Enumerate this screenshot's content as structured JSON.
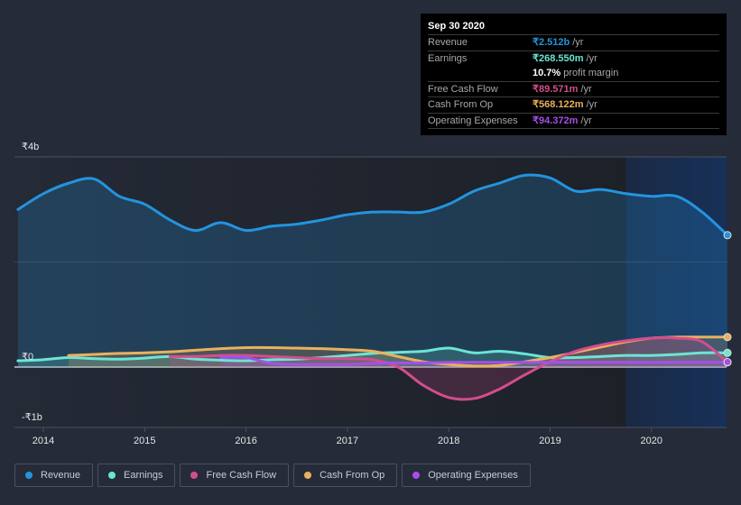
{
  "tooltip": {
    "date": "Sep 30 2020",
    "rows": [
      {
        "label": "Revenue",
        "value": "₹2.512b",
        "unit": "/yr",
        "color": "#2394df"
      },
      {
        "label": "Earnings",
        "value": "₹268.550m",
        "unit": "/yr",
        "color": "#6ce5d4"
      },
      {
        "label": "",
        "value": "10.7%",
        "unit": "profit margin",
        "color": "#ffffff"
      },
      {
        "label": "Free Cash Flow",
        "value": "₹89.571m",
        "unit": "/yr",
        "color": "#d34d8e"
      },
      {
        "label": "Cash From Op",
        "value": "₹568.122m",
        "unit": "/yr",
        "color": "#e9b15e"
      },
      {
        "label": "Operating Expenses",
        "value": "₹94.372m",
        "unit": "/yr",
        "color": "#a650e8"
      }
    ]
  },
  "legend": [
    {
      "label": "Revenue",
      "color": "#2394df"
    },
    {
      "label": "Earnings",
      "color": "#6ce5d4"
    },
    {
      "label": "Free Cash Flow",
      "color": "#d34d8e"
    },
    {
      "label": "Cash From Op",
      "color": "#e9b15e"
    },
    {
      "label": "Operating Expenses",
      "color": "#a650e8"
    }
  ],
  "chart_data": {
    "type": "area",
    "title": "",
    "xlabel": "",
    "ylabel": "",
    "ylim": [
      -1.0,
      4.0
    ],
    "xlim": [
      2013.7,
      2020.75
    ],
    "y_ticks": [
      {
        "v": 4,
        "label": "₹4b"
      },
      {
        "v": 0,
        "label": "₹0"
      },
      {
        "v": -1,
        "label": "-₹1b"
      }
    ],
    "x_ticks": [
      {
        "v": 2014,
        "label": "2014"
      },
      {
        "v": 2015,
        "label": "2015"
      },
      {
        "v": 2016,
        "label": "2016"
      },
      {
        "v": 2017,
        "label": "2017"
      },
      {
        "v": 2018,
        "label": "2018"
      },
      {
        "v": 2019,
        "label": "2019"
      },
      {
        "v": 2020,
        "label": "2020"
      }
    ],
    "highlight_start": 2019.75,
    "units": "INR billions",
    "series": [
      {
        "name": "Revenue",
        "color": "#2394df",
        "x": [
          2013.75,
          2014.0,
          2014.25,
          2014.5,
          2014.75,
          2015.0,
          2015.25,
          2015.5,
          2015.75,
          2016.0,
          2016.25,
          2016.5,
          2016.75,
          2017.0,
          2017.25,
          2017.5,
          2017.75,
          2018.0,
          2018.25,
          2018.5,
          2018.75,
          2019.0,
          2019.25,
          2019.5,
          2019.75,
          2020.0,
          2020.25,
          2020.5,
          2020.75
        ],
        "y": [
          3.0,
          3.3,
          3.5,
          3.58,
          3.25,
          3.1,
          2.8,
          2.6,
          2.75,
          2.6,
          2.68,
          2.72,
          2.8,
          2.9,
          2.95,
          2.95,
          2.95,
          3.1,
          3.35,
          3.5,
          3.65,
          3.6,
          3.35,
          3.38,
          3.3,
          3.25,
          3.25,
          2.95,
          2.51
        ]
      },
      {
        "name": "Earnings",
        "color": "#6ce5d4",
        "x": [
          2013.75,
          2014.0,
          2014.25,
          2014.5,
          2014.75,
          2015.0,
          2015.25,
          2015.5,
          2015.75,
          2016.0,
          2016.25,
          2016.5,
          2016.75,
          2017.0,
          2017.25,
          2017.5,
          2017.75,
          2018.0,
          2018.25,
          2018.5,
          2018.75,
          2019.0,
          2019.25,
          2019.5,
          2019.75,
          2020.0,
          2020.25,
          2020.5,
          2020.75
        ],
        "y": [
          0.12,
          0.14,
          0.18,
          0.16,
          0.15,
          0.17,
          0.2,
          0.15,
          0.13,
          0.12,
          0.14,
          0.15,
          0.18,
          0.22,
          0.26,
          0.28,
          0.3,
          0.36,
          0.27,
          0.3,
          0.25,
          0.18,
          0.18,
          0.2,
          0.22,
          0.22,
          0.24,
          0.27,
          0.27
        ]
      },
      {
        "name": "Free Cash Flow",
        "color": "#d34d8e",
        "x": [
          2015.25,
          2015.5,
          2015.75,
          2016.0,
          2016.25,
          2016.5,
          2016.75,
          2017.0,
          2017.25,
          2017.5,
          2017.75,
          2018.0,
          2018.25,
          2018.5,
          2018.75,
          2019.0,
          2019.25,
          2019.5,
          2019.75,
          2020.0,
          2020.25,
          2020.5,
          2020.75
        ],
        "y": [
          0.2,
          0.2,
          0.22,
          0.22,
          0.2,
          0.18,
          0.16,
          0.16,
          0.14,
          0.0,
          -0.35,
          -0.58,
          -0.6,
          -0.42,
          -0.15,
          0.1,
          0.3,
          0.42,
          0.5,
          0.55,
          0.55,
          0.48,
          0.09
        ]
      },
      {
        "name": "Cash From Op",
        "color": "#e9b15e",
        "x": [
          2014.25,
          2014.5,
          2014.75,
          2015.0,
          2015.25,
          2015.5,
          2015.75,
          2016.0,
          2016.25,
          2016.5,
          2016.75,
          2017.0,
          2017.25,
          2017.5,
          2017.75,
          2018.0,
          2018.25,
          2018.5,
          2018.75,
          2019.0,
          2019.25,
          2019.5,
          2019.75,
          2020.0,
          2020.25,
          2020.5,
          2020.75
        ],
        "y": [
          0.22,
          0.24,
          0.26,
          0.27,
          0.29,
          0.32,
          0.35,
          0.37,
          0.37,
          0.36,
          0.35,
          0.33,
          0.3,
          0.2,
          0.1,
          0.05,
          0.02,
          0.03,
          0.1,
          0.18,
          0.28,
          0.38,
          0.48,
          0.55,
          0.57,
          0.57,
          0.57
        ]
      },
      {
        "name": "Operating Expenses",
        "color": "#a650e8",
        "x": [
          2015.75,
          2016.0,
          2016.25,
          2016.5,
          2016.75,
          2017.0,
          2017.25,
          2017.5,
          2017.75,
          2018.0,
          2018.25,
          2018.5,
          2018.75,
          2019.0,
          2019.25,
          2019.5,
          2019.75,
          2020.0,
          2020.25,
          2020.5,
          2020.75
        ],
        "y": [
          0.18,
          0.18,
          0.07,
          0.05,
          0.05,
          0.05,
          0.07,
          0.08,
          0.08,
          0.09,
          0.09,
          0.09,
          0.09,
          0.09,
          0.09,
          0.09,
          0.09,
          0.09,
          0.09,
          0.09,
          0.094
        ]
      }
    ]
  }
}
